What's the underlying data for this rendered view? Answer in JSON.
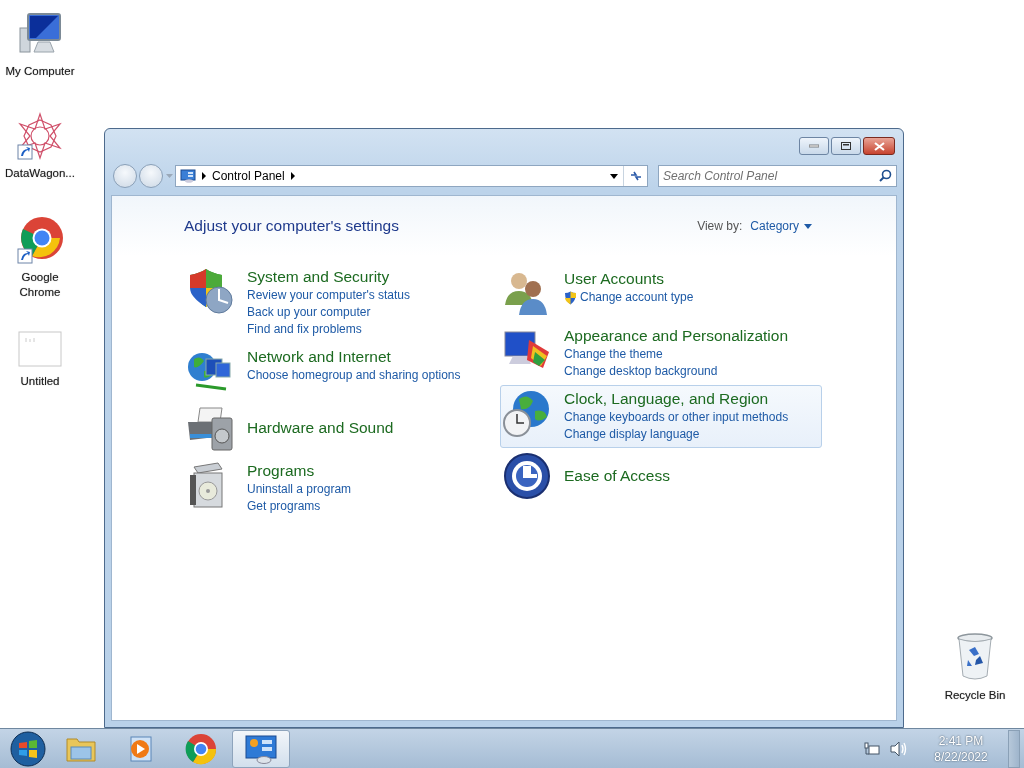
{
  "desktop_icons": [
    {
      "kind": "computer",
      "label": "My Computer",
      "shortcut": false
    },
    {
      "kind": "star",
      "label": "DataWagon...",
      "shortcut": true
    },
    {
      "kind": "browser",
      "label": "Google Chrome",
      "shortcut": true
    },
    {
      "kind": "document",
      "label": "Untitled",
      "shortcut": false
    },
    {
      "kind": "trash",
      "label": "Recycle Bin",
      "shortcut": false
    }
  ],
  "window": {
    "breadcrumb": [
      "Control Panel"
    ],
    "search": {
      "placeholder": "Search Control Panel"
    },
    "heading": "Adjust your computer's settings",
    "view_by": {
      "label": "View by:",
      "value": "Category"
    },
    "columns": [
      {
        "categories": [
          {
            "kind": "security",
            "title": "System and Security",
            "selected": false,
            "links": [
              {
                "text": "Review your computer's status",
                "admin": false
              },
              {
                "text": "Back up your computer",
                "admin": false
              },
              {
                "text": "Find and fix problems",
                "admin": false
              }
            ]
          },
          {
            "kind": "network",
            "title": "Network and Internet",
            "selected": false,
            "links": [
              {
                "text": "Choose homegroup and sharing options",
                "admin": false
              }
            ]
          },
          {
            "kind": "hardware",
            "title": "Hardware and Sound",
            "selected": false
          },
          {
            "kind": "programs",
            "title": "Programs",
            "selected": false,
            "links": [
              {
                "text": "Uninstall a program",
                "admin": false
              },
              {
                "text": "Get programs",
                "admin": false
              }
            ]
          }
        ]
      },
      {
        "categories": [
          {
            "kind": "users",
            "title": "User Accounts",
            "selected": false,
            "links": [
              {
                "text": "Change account type",
                "admin": true
              }
            ]
          },
          {
            "kind": "appearance",
            "title": "Appearance and Personalization",
            "selected": false,
            "links": [
              {
                "text": "Change the theme",
                "admin": false
              },
              {
                "text": "Change desktop background",
                "admin": false
              }
            ]
          },
          {
            "kind": "clock",
            "title": "Clock, Language, and Region",
            "selected": true,
            "links": [
              {
                "text": "Change keyboards or other input methods",
                "admin": false
              },
              {
                "text": "Change display language",
                "admin": false
              }
            ]
          },
          {
            "kind": "access",
            "title": "Ease of Access",
            "selected": false
          }
        ]
      }
    ]
  },
  "taskbar": {
    "items": [
      {
        "kind": "start",
        "selected": false
      },
      {
        "kind": "folder",
        "selected": false
      },
      {
        "kind": "media",
        "selected": false
      },
      {
        "kind": "browser",
        "selected": false
      },
      {
        "kind": "control-panel",
        "selected": true
      }
    ],
    "time": "2:41 PM",
    "date": "8/22/2022"
  }
}
